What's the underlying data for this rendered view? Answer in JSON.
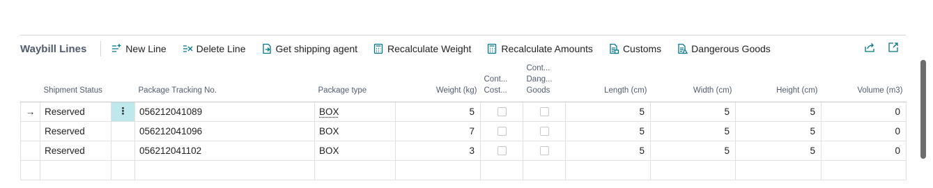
{
  "part": {
    "title": "Waybill Lines",
    "actions": [
      {
        "label": "New Line",
        "icon": "new-line-icon"
      },
      {
        "label": "Delete Line",
        "icon": "delete-line-icon"
      },
      {
        "label": "Get shipping agent",
        "icon": "get-document-icon"
      },
      {
        "label": "Recalculate Weight",
        "icon": "calculator-icon"
      },
      {
        "label": "Recalculate Amounts",
        "icon": "calculator-icon"
      },
      {
        "label": "Customs",
        "icon": "customs-icon"
      },
      {
        "label": "Dangerous Goods",
        "icon": "dangerous-goods-icon"
      }
    ],
    "right_icons": [
      "share-icon",
      "expand-icon"
    ]
  },
  "columns": {
    "shipment_status": "Shipment Status",
    "tracking": "Package Tracking No.",
    "package_type": "Package type",
    "weight": "Weight (kg)",
    "cont_cost": "Cont... Cost...",
    "cont_dang_1": "Cont...",
    "cont_dang_2": "Dang...",
    "cont_dang_3": "Goods",
    "length": "Length (cm)",
    "width": "Width (cm)",
    "height": "Height (cm)",
    "volume": "Volume (m3)"
  },
  "rows": [
    {
      "status": "Reserved",
      "tracking": "056212041089",
      "package_type": "BOX",
      "weight": "5",
      "cost_checked": false,
      "dang_checked": false,
      "length": "5",
      "width": "5",
      "height": "5",
      "volume": "0",
      "current": true
    },
    {
      "status": "Reserved",
      "tracking": "056212041096",
      "package_type": "BOX",
      "weight": "7",
      "cost_checked": false,
      "dang_checked": false,
      "length": "5",
      "width": "5",
      "height": "5",
      "volume": "0",
      "current": false
    },
    {
      "status": "Reserved",
      "tracking": "056212041102",
      "package_type": "BOX",
      "weight": "3",
      "cost_checked": false,
      "dang_checked": false,
      "length": "5",
      "width": "5",
      "height": "5",
      "volume": "0",
      "current": false
    }
  ],
  "row_indicator": "→",
  "row_menu": "⋮",
  "colors": {
    "accent": "#00758a",
    "dots_bg": "#bfe8ed",
    "title": "#505c6d"
  }
}
